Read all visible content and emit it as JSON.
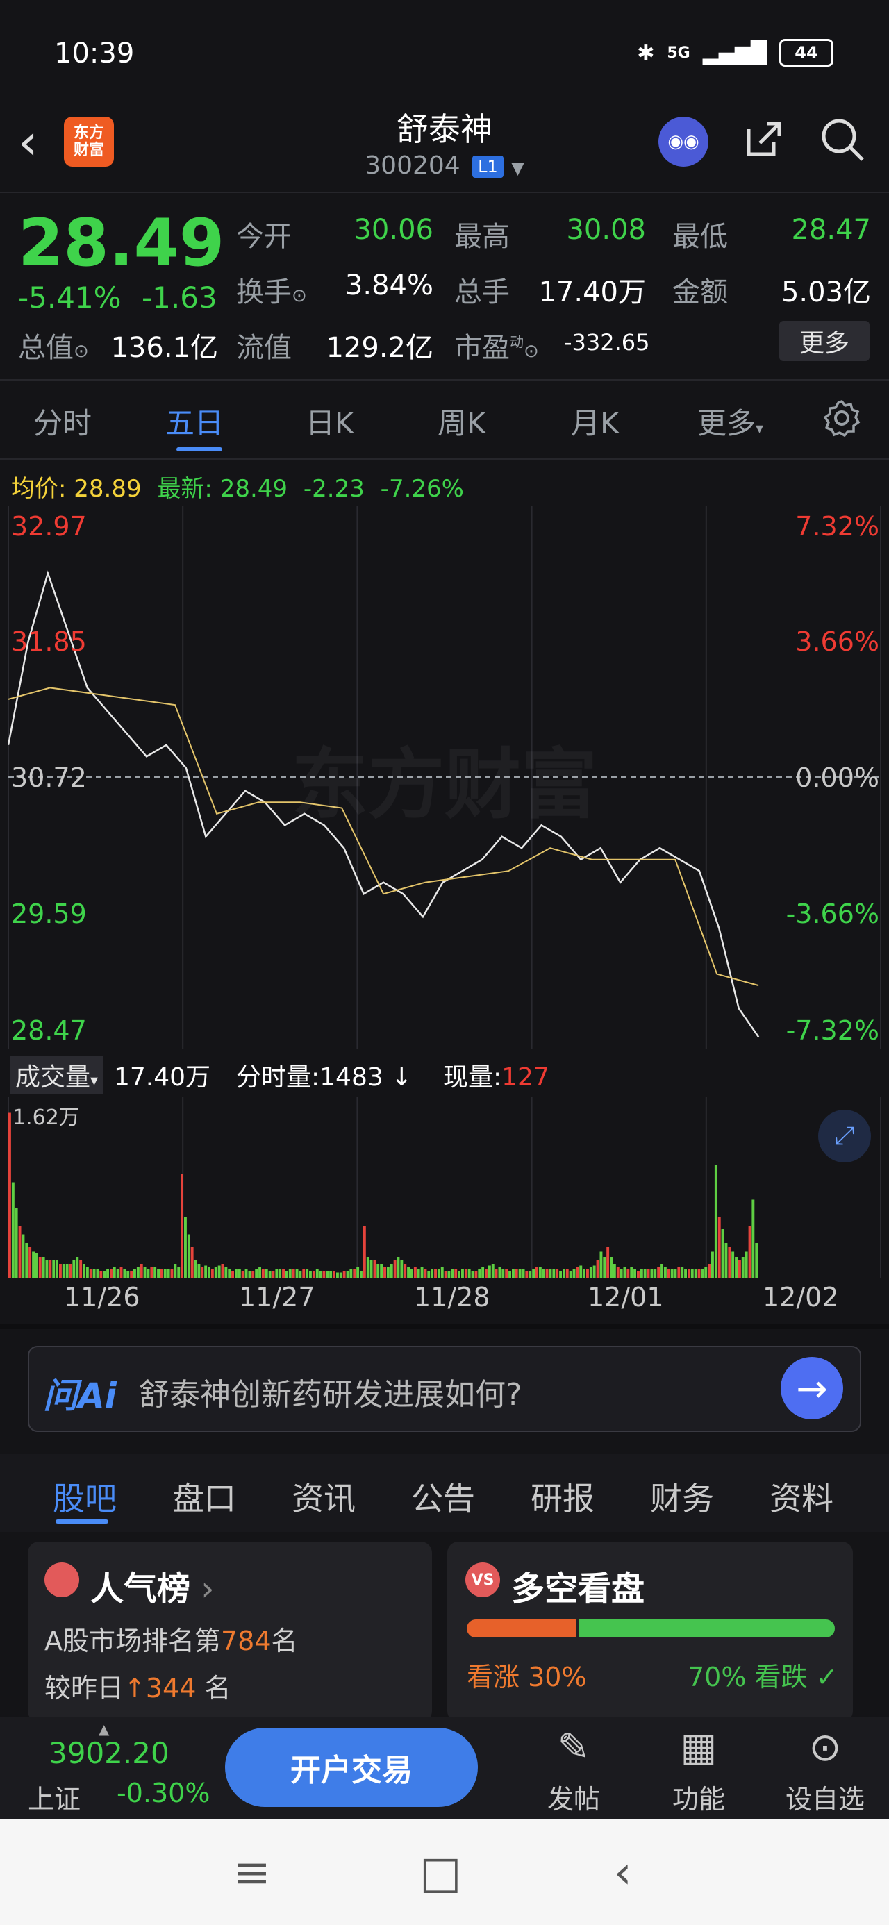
{
  "status_bar": {
    "time": "10:39",
    "network": "5G",
    "battery": "44"
  },
  "header": {
    "logo_line1": "东方",
    "logo_line2": "财富",
    "stock_name": "舒泰神",
    "stock_code": "300204",
    "level_badge": "L1"
  },
  "quote": {
    "price": "28.49",
    "change_pct": "-5.41%",
    "change": "-1.63",
    "open_label": "今开",
    "open": "30.06",
    "high_label": "最高",
    "high": "30.08",
    "low_label": "最低",
    "low": "28.47",
    "turnover_label": "换手",
    "turnover": "3.84%",
    "volume_label": "总手",
    "volume": "17.40万",
    "amount_label": "金额",
    "amount": "5.03亿",
    "mktcap_label": "总值",
    "mktcap": "136.1亿",
    "float_label": "流值",
    "float": "129.2亿",
    "pe_label": "市盈",
    "pe_sup": "动",
    "pe": "-332.65",
    "more_label": "更多"
  },
  "period_tabs": [
    "分时",
    "五日",
    "日K",
    "周K",
    "月K",
    "更多"
  ],
  "summary": {
    "avg_label": "均价:",
    "avg": "28.89",
    "latest_label": "最新:",
    "latest": "28.49",
    "chg": "-2.23",
    "chg_pct": "-7.26%"
  },
  "chart_data": {
    "type": "line",
    "y_left_ticks": [
      "32.97",
      "31.85",
      "30.72",
      "29.59",
      "28.47"
    ],
    "y_right_ticks": [
      "7.32%",
      "3.66%",
      "0.00%",
      "-3.66%",
      "-7.32%"
    ],
    "x_categories": [
      "11/26",
      "11/27",
      "11/28",
      "12/01",
      "12/02"
    ],
    "series": [
      {
        "name": "最新",
        "color": "#e8e8e8",
        "values": [
          31.0,
          31.9,
          32.5,
          32.0,
          31.5,
          31.3,
          31.1,
          30.9,
          31.0,
          30.8,
          30.2,
          30.4,
          30.6,
          30.5,
          30.3,
          30.4,
          30.3,
          30.1,
          29.7,
          29.8,
          29.7,
          29.5,
          29.8,
          29.9,
          30.0,
          30.2,
          30.1,
          30.3,
          30.2,
          30.0,
          30.1,
          29.8,
          30.0,
          30.1,
          30.0,
          29.9,
          29.4,
          28.7,
          28.45
        ]
      },
      {
        "name": "均价",
        "color": "#e3c46a",
        "values": [
          31.4,
          31.5,
          31.45,
          31.4,
          31.35,
          30.4,
          30.5,
          30.5,
          30.45,
          29.7,
          29.8,
          29.85,
          29.9,
          30.1,
          30.0,
          30.0,
          30.0,
          29.0,
          28.9
        ]
      }
    ],
    "prev_close": 30.72
  },
  "volume": {
    "label": "成交量",
    "total": "17.40万",
    "tick_label": "分时量:",
    "tick_val": "1483",
    "now_label": "现量:",
    "now_val": "127",
    "max_label": "1.62万",
    "bars": [
      0.95,
      0.55,
      0.4,
      0.3,
      0.25,
      0.2,
      0.18,
      0.15,
      0.14,
      0.12,
      0.12,
      0.1,
      0.1,
      0.1,
      0.1,
      0.08,
      0.08,
      0.08,
      0.08,
      0.1,
      0.12,
      0.1,
      0.08,
      0.06,
      0.05,
      0.05,
      0.05,
      0.04,
      0.04,
      0.05,
      0.05,
      0.06,
      0.05,
      0.06,
      0.05,
      0.04,
      0.04,
      0.05,
      0.06,
      0.08,
      0.06,
      0.05,
      0.06,
      0.06,
      0.05,
      0.05,
      0.05,
      0.05,
      0.05,
      0.08,
      0.06,
      0.6,
      0.35,
      0.25,
      0.18,
      0.1,
      0.08,
      0.06,
      0.07,
      0.06,
      0.05,
      0.06,
      0.07,
      0.08,
      0.06,
      0.05,
      0.04,
      0.05,
      0.05,
      0.04,
      0.05,
      0.04,
      0.04,
      0.05,
      0.06,
      0.05,
      0.05,
      0.04,
      0.04,
      0.05,
      0.05,
      0.05,
      0.04,
      0.05,
      0.05,
      0.05,
      0.04,
      0.05,
      0.05,
      0.04,
      0.04,
      0.05,
      0.04,
      0.04,
      0.04,
      0.04,
      0.04,
      0.03,
      0.03,
      0.04,
      0.04,
      0.05,
      0.05,
      0.06,
      0.04,
      0.3,
      0.12,
      0.1,
      0.1,
      0.08,
      0.08,
      0.06,
      0.06,
      0.08,
      0.1,
      0.12,
      0.1,
      0.08,
      0.06,
      0.05,
      0.06,
      0.05,
      0.06,
      0.05,
      0.04,
      0.05,
      0.05,
      0.05,
      0.06,
      0.04,
      0.04,
      0.05,
      0.05,
      0.04,
      0.05,
      0.05,
      0.05,
      0.04,
      0.04,
      0.05,
      0.06,
      0.05,
      0.07,
      0.08,
      0.05,
      0.06,
      0.05,
      0.05,
      0.04,
      0.05,
      0.05,
      0.05,
      0.05,
      0.04,
      0.04,
      0.05,
      0.06,
      0.06,
      0.05,
      0.05,
      0.05,
      0.05,
      0.05,
      0.04,
      0.05,
      0.05,
      0.04,
      0.05,
      0.06,
      0.07,
      0.05,
      0.05,
      0.06,
      0.07,
      0.1,
      0.15,
      0.12,
      0.18,
      0.12,
      0.08,
      0.06,
      0.05,
      0.06,
      0.05,
      0.06,
      0.05,
      0.04,
      0.05,
      0.05,
      0.05,
      0.05,
      0.05,
      0.06,
      0.08,
      0.06,
      0.05,
      0.05,
      0.05,
      0.06,
      0.06,
      0.05,
      0.05,
      0.05,
      0.05,
      0.05,
      0.05,
      0.06,
      0.08,
      0.15,
      0.65,
      0.35,
      0.28,
      0.2,
      0.18,
      0.15,
      0.12,
      0.1,
      0.12,
      0.15,
      0.3,
      0.45,
      0.2
    ]
  },
  "ai_bar": {
    "tag": "问Ai",
    "question": "舒泰神创新药研发进展如何?"
  },
  "section_tabs": [
    "股吧",
    "盘口",
    "资讯",
    "公告",
    "研报",
    "财务",
    "资料"
  ],
  "popularity_card": {
    "title": "人气榜",
    "line1_prefix": "A股市场排名第",
    "rank": "784",
    "line1_suffix": "名",
    "line2_prefix": "较昨日",
    "rise": "344",
    "line2_suffix": "名"
  },
  "sentiment_card": {
    "badge": "VS",
    "title": "多空看盘",
    "bull_label": "看涨",
    "bull_pct": "30%",
    "bear_pct": "70%",
    "bear_label": "看跌",
    "bull_fraction": 0.3
  },
  "bottom_bar": {
    "index_value": "3902.20",
    "index_name": "上证",
    "index_change": "-0.30%",
    "trade_label": "开户交易",
    "post_label": "发帖",
    "func_label": "功能",
    "watch_label": "设自选"
  }
}
